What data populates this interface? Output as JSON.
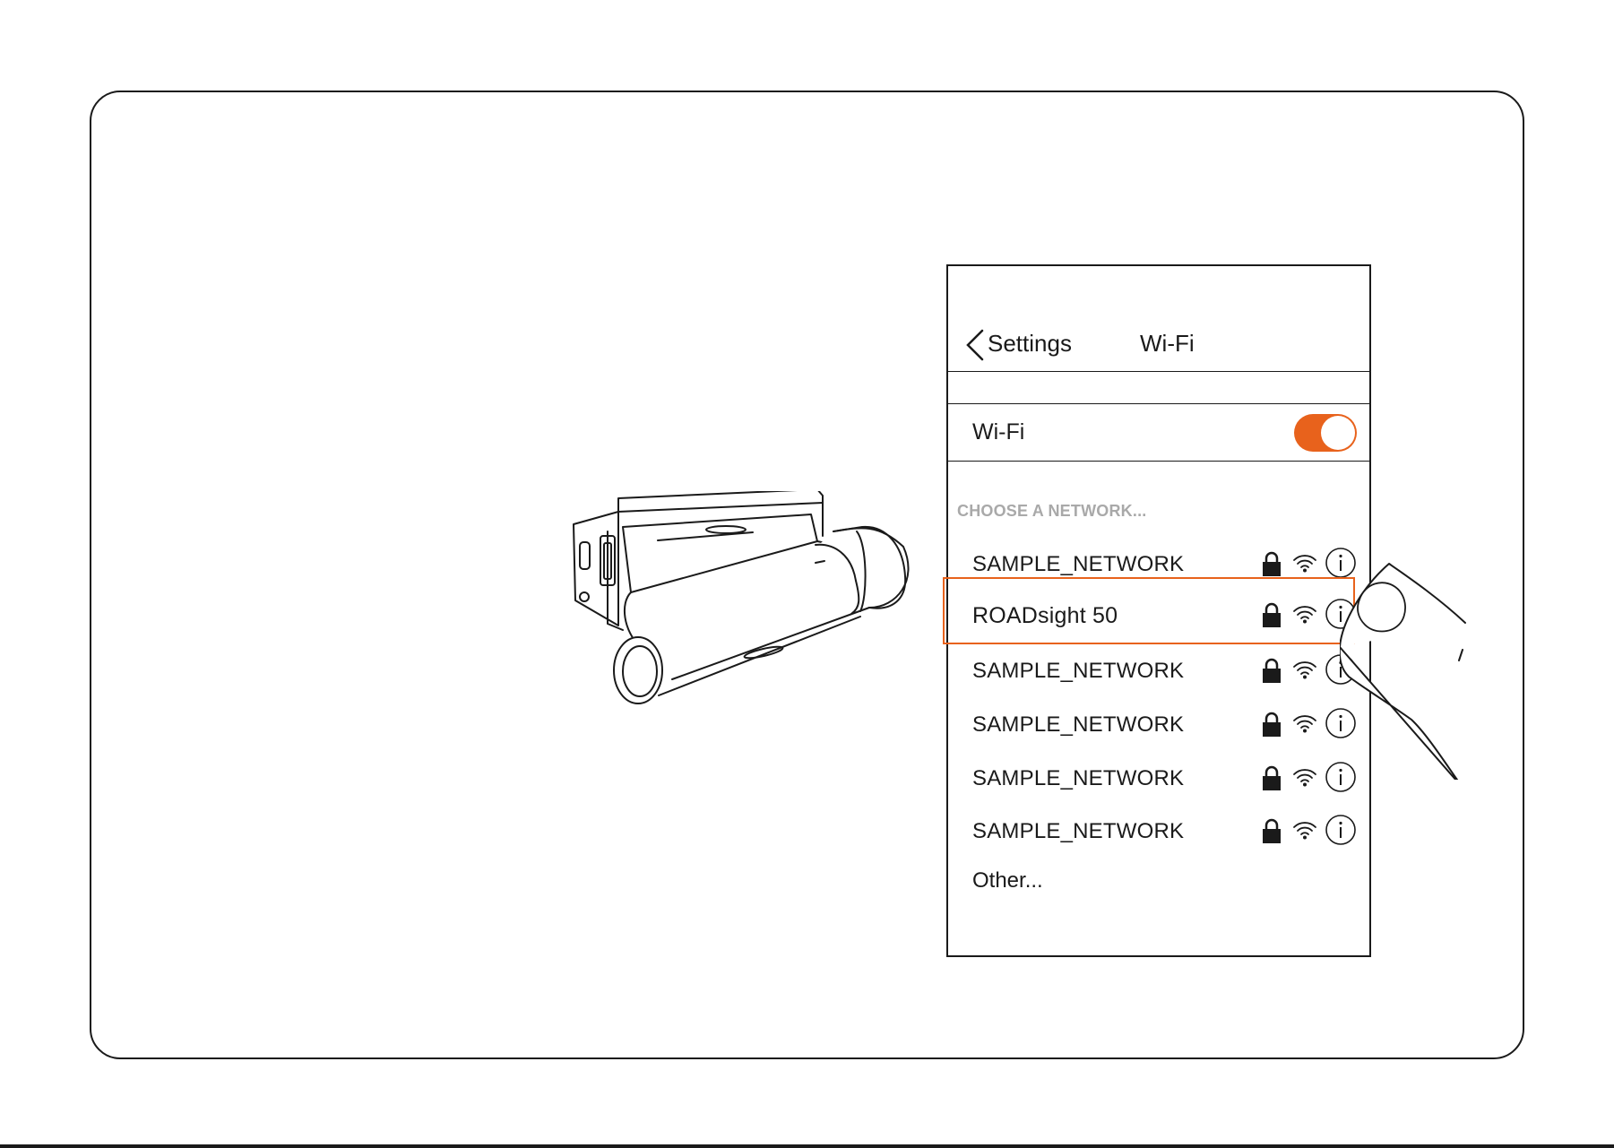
{
  "nav": {
    "back_label": "Settings",
    "title": "Wi-Fi"
  },
  "wifi_toggle": {
    "label": "Wi-Fi",
    "state": "on",
    "color": "#e8621c"
  },
  "network_section": {
    "header": "CHOOSE A NETWORK...",
    "networks": [
      {
        "name": "SAMPLE_NETWORK",
        "locked": true,
        "selected": false
      },
      {
        "name": "ROADsight 50",
        "locked": true,
        "selected": true
      },
      {
        "name": "SAMPLE_NETWORK",
        "locked": true,
        "selected": false
      },
      {
        "name": "SAMPLE_NETWORK",
        "locked": true,
        "selected": false
      },
      {
        "name": "SAMPLE_NETWORK",
        "locked": true,
        "selected": false
      },
      {
        "name": "SAMPLE_NETWORK",
        "locked": true,
        "selected": false
      }
    ],
    "other_label": "Other..."
  },
  "icons": {
    "back": "chevron-left-icon",
    "lock": "lock-icon",
    "signal": "wifi-signal-icon",
    "info": "info-icon"
  },
  "colors": {
    "accent": "#e8621c",
    "section_header": "#a9a9a9",
    "line": "#1a1a1a"
  }
}
